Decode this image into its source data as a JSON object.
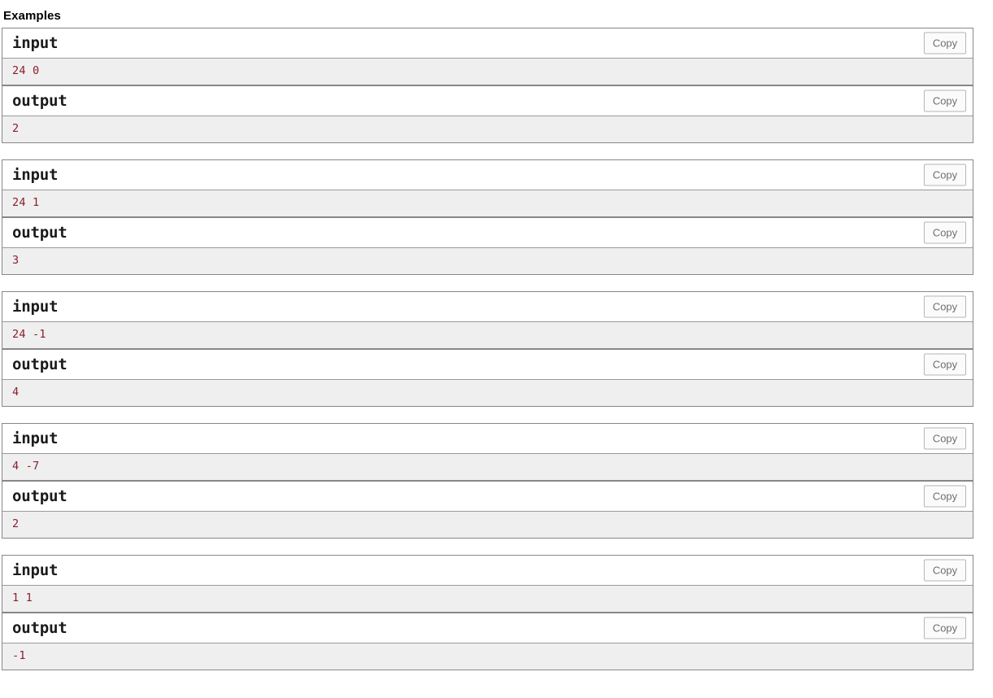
{
  "section": {
    "title": "Examples"
  },
  "labels": {
    "input": "input",
    "output": "output",
    "copy": "Copy"
  },
  "colors": {
    "data_text": "#8a1f2b",
    "data_background": "#efefef",
    "border": "#888888",
    "copy_text": "#6f6f6f",
    "title_text": "#1b1b1b"
  },
  "examples": [
    {
      "input_label": "input",
      "output_label": "output",
      "copy_input_label": "Copy",
      "copy_output_label": "Copy",
      "input": "24 0",
      "output": "2"
    },
    {
      "input_label": "input",
      "output_label": "output",
      "copy_input_label": "Copy",
      "copy_output_label": "Copy",
      "input": "24 1",
      "output": "3"
    },
    {
      "input_label": "input",
      "output_label": "output",
      "copy_input_label": "Copy",
      "copy_output_label": "Copy",
      "input": "24 -1",
      "output": "4"
    },
    {
      "input_label": "input",
      "output_label": "output",
      "copy_input_label": "Copy",
      "copy_output_label": "Copy",
      "input": "4 -7",
      "output": "2"
    },
    {
      "input_label": "input",
      "output_label": "output",
      "copy_input_label": "Copy",
      "copy_output_label": "Copy",
      "input": "1 1",
      "output": "-1"
    }
  ]
}
